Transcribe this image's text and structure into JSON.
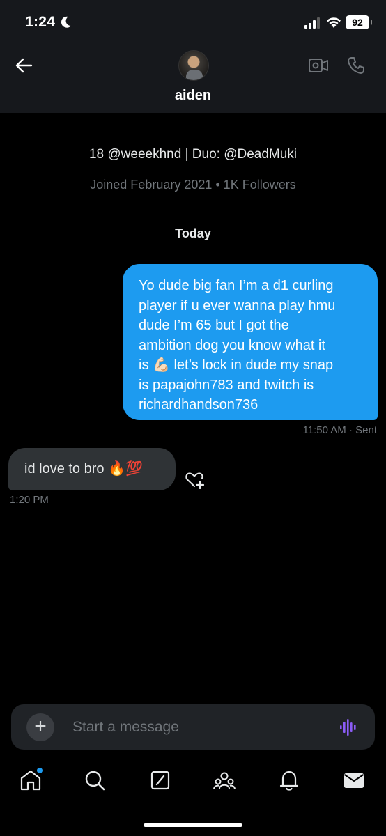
{
  "status_bar": {
    "time": "1:24",
    "battery": "92",
    "icons": [
      "moon-icon",
      "signal-icon",
      "wifi-icon",
      "battery-icon"
    ]
  },
  "header": {
    "title": "aiden",
    "icons": [
      "back-arrow-icon",
      "avatar",
      "video-call-icon",
      "phone-icon"
    ]
  },
  "profile": {
    "bio": "18 @weeekhnd | Duo: @DeadMuki",
    "joined": "Joined February 2021 • 1K Followers"
  },
  "conversation": {
    "day_label": "Today",
    "messages": [
      {
        "direction": "outgoing",
        "lines": [
          "Yo dude big fan I’m a d1 curling",
          "player if u ever wanna play hmu",
          "dude I’m 65 but I got the",
          "ambition dog you know what it",
          "is 💪🏻 let’s lock in dude my snap",
          "is papajohn783 and twitch is",
          "richardhandson736"
        ],
        "time": "11:50 AM",
        "status": "· Sent"
      },
      {
        "direction": "incoming",
        "text": "id love to bro 🔥💯",
        "time": "1:20 PM"
      }
    ]
  },
  "composer": {
    "plus_label": "+",
    "placeholder": "Start a message"
  },
  "tabbar": {
    "items": [
      "home-icon",
      "search-icon",
      "grok-icon",
      "communities-icon",
      "notifications-icon",
      "messages-icon"
    ]
  },
  "colors": {
    "accent": "#1d9bf0",
    "background": "#000000",
    "header_bg": "#16181c",
    "incoming_bubble": "#2f3336",
    "muted_text": "#71767b",
    "voice_accent": "#8b5cf6"
  }
}
